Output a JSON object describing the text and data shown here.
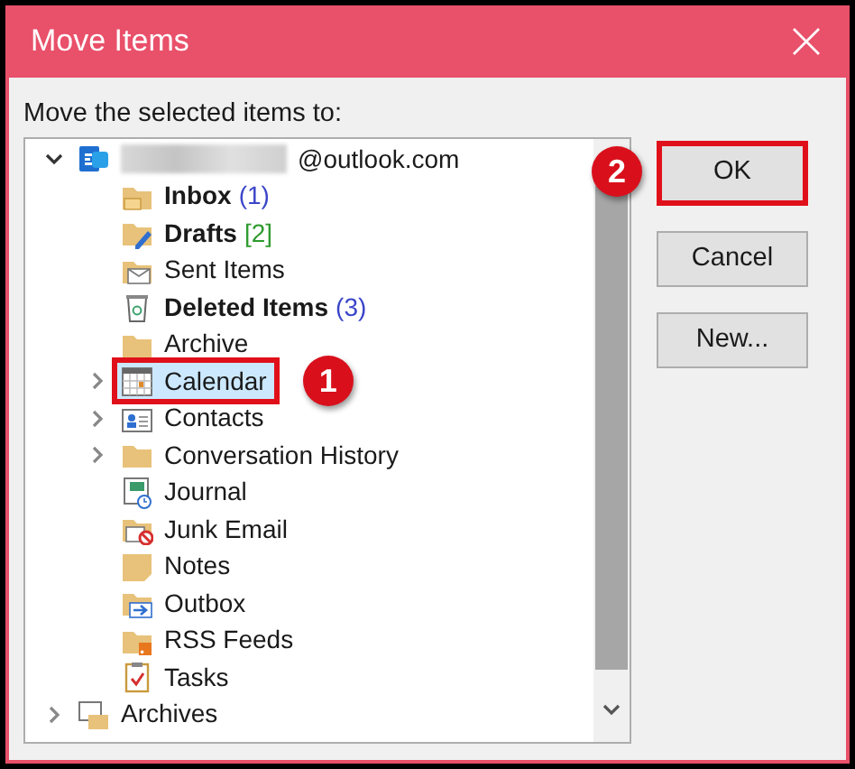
{
  "window": {
    "title": "Move Items"
  },
  "prompt": "Move the selected items to:",
  "tree": [
    {
      "label": "@outlook.com",
      "kind": "account",
      "expanded": true,
      "selected": false,
      "unread": false,
      "children": [
        {
          "label": "Inbox",
          "count": "(1)",
          "color": "#3b46c9",
          "kind": "inbox",
          "unread": true,
          "selected": false
        },
        {
          "label": "Drafts",
          "count": "[2]",
          "color": "#2f9a2f",
          "kind": "drafts",
          "unread": true,
          "selected": false
        },
        {
          "label": "Sent Items",
          "kind": "sent",
          "unread": false,
          "selected": false
        },
        {
          "label": "Deleted Items",
          "count": "(3)",
          "color": "#3b46c9",
          "kind": "deleted",
          "unread": true,
          "selected": false
        },
        {
          "label": "Archive",
          "kind": "folder",
          "unread": false,
          "selected": false
        },
        {
          "label": "Calendar",
          "kind": "calendar",
          "unread": false,
          "selected": true,
          "highlighted": true,
          "callout": "1",
          "expanded": false,
          "has_children": true
        },
        {
          "label": "Contacts",
          "kind": "contacts",
          "unread": false,
          "selected": false,
          "expanded": false,
          "has_children": true
        },
        {
          "label": "Conversation History",
          "kind": "folder",
          "unread": false,
          "selected": false,
          "expanded": false,
          "has_children": true
        },
        {
          "label": "Journal",
          "kind": "journal",
          "unread": false,
          "selected": false
        },
        {
          "label": "Junk Email",
          "kind": "junk",
          "unread": false,
          "selected": false
        },
        {
          "label": "Notes",
          "kind": "notes",
          "unread": false,
          "selected": false
        },
        {
          "label": "Outbox",
          "kind": "outbox",
          "unread": false,
          "selected": false
        },
        {
          "label": "RSS Feeds",
          "kind": "rss",
          "unread": false,
          "selected": false
        },
        {
          "label": "Tasks",
          "kind": "tasks",
          "unread": false,
          "selected": false
        }
      ]
    },
    {
      "label": "Archives",
      "kind": "archives",
      "expanded": false,
      "selected": false,
      "unread": false,
      "has_children": true
    }
  ],
  "buttons": [
    {
      "label": "OK",
      "highlighted": true,
      "callout": "2"
    },
    {
      "label": "Cancel",
      "highlighted": false
    },
    {
      "label": "New...",
      "highlighted": false
    }
  ]
}
